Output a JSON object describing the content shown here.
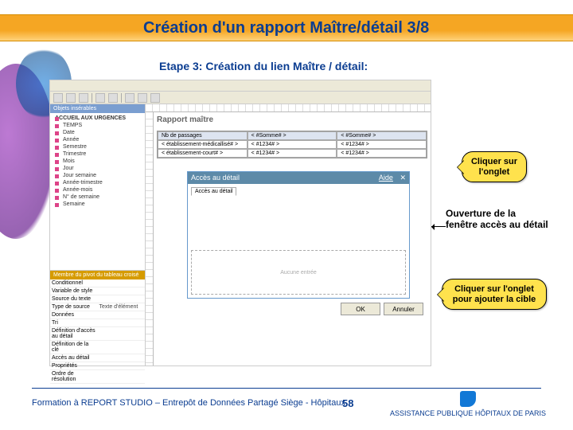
{
  "slide": {
    "title": "Création d'un rapport Maître/détail 3/8",
    "step_label": "Etape 3: Création du lien Maître / détail:",
    "footer": "Formation à REPORT STUDIO – Entrepôt de Données Partagé Siège - Hôpitaux",
    "number": "58",
    "logo_text": "ASSISTANCE PUBLIQUE\nHÔPITAUX DE PARIS"
  },
  "callouts": {
    "c1": "Cliquer sur l'onglet",
    "note": "Ouverture de la fenêtre accès au détail",
    "c2": "Cliquer sur l'onglet pour ajouter la cible"
  },
  "app": {
    "tree_header": "Objets insérables",
    "tree_root": "ACCUEIL AUX URGENCES",
    "tree_items": [
      "TEMPS",
      "Date",
      "Année",
      "Semestre",
      "Trimestre",
      "Mois",
      "Jour",
      "Jour semaine",
      "Année-trimestre",
      "Année-mois",
      "N° de semaine",
      "Semaine"
    ],
    "props_header": "Membre du pivot du tableau croisé",
    "props": [
      {
        "k": "Conditionnel",
        "v": ""
      },
      {
        "k": "Variable de style",
        "v": ""
      },
      {
        "k": "Source du texte",
        "v": ""
      },
      {
        "k": "Type de source",
        "v": "Texte d'élément"
      },
      {
        "k": "Données",
        "v": ""
      },
      {
        "k": "Tri",
        "v": ""
      },
      {
        "k": "Définition d'accès au détail",
        "v": ""
      },
      {
        "k": "Définition de la clé",
        "v": ""
      },
      {
        "k": "Accès au détail",
        "v": ""
      },
      {
        "k": "Propriétés",
        "v": ""
      },
      {
        "k": "Ordre de résolution",
        "v": ""
      }
    ],
    "report_title": "Rapport maître",
    "table": {
      "headers": [
        "Nb de passages",
        "< #Somme# >",
        "< #Somme# >"
      ],
      "row": [
        "< établissement-médicallisé# >",
        "< #1234# >",
        "< #1234# >"
      ],
      "row2": [
        "< établissement-court# >",
        "< #1234# >",
        "< #1234# >"
      ]
    },
    "detail": {
      "title": "Accès au détail",
      "aide": "Aide",
      "close": "✕",
      "tab_label": "Accès au détail",
      "drop_hint": "Aucune entrée",
      "ok": "OK",
      "cancel": "Annuler"
    }
  }
}
